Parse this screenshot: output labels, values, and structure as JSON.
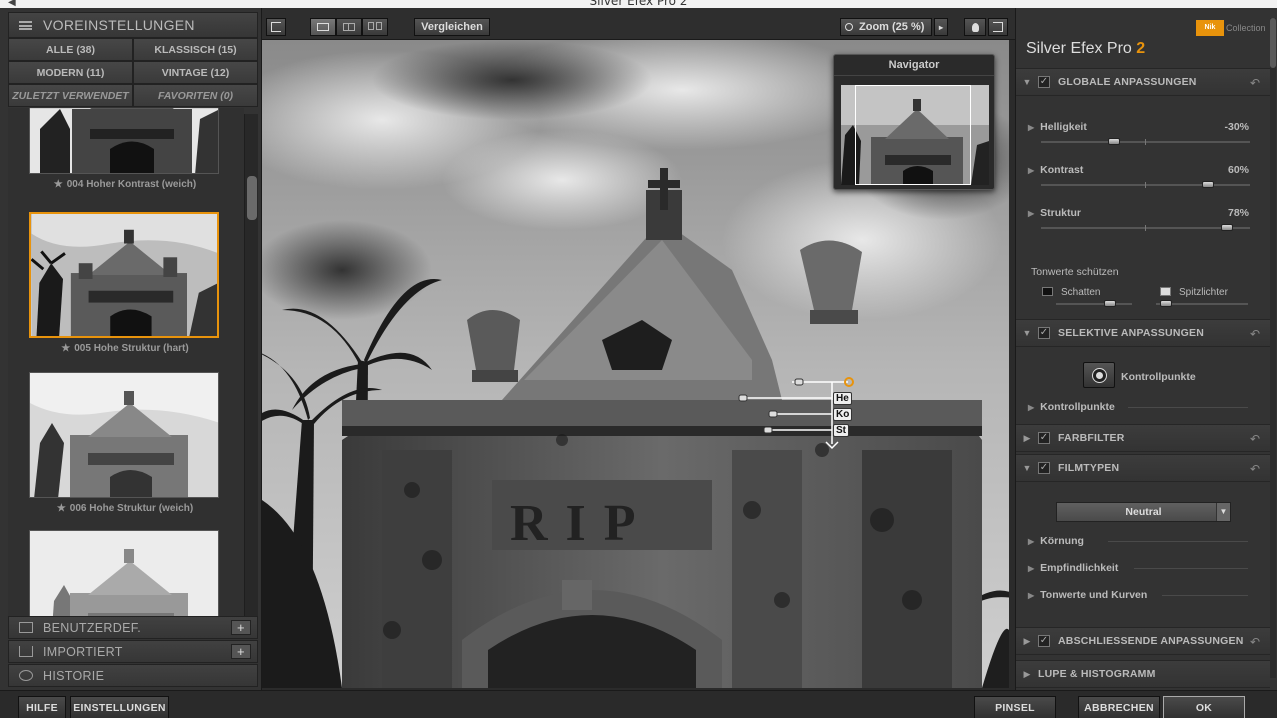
{
  "window": {
    "title": "Silver Efex Pro 2"
  },
  "left_panel": {
    "header": "VOREINSTELLUNGEN",
    "filters": [
      {
        "label": "ALLE (38)"
      },
      {
        "label": "KLASSISCH (15)"
      },
      {
        "label": "MODERN (11)"
      },
      {
        "label": "VINTAGE (12)"
      },
      {
        "label": "ZULETZT VERWENDET"
      },
      {
        "label": "FAVORITEN (0)"
      }
    ],
    "presets": [
      {
        "label": "004 Hoher Kontrast (weich)"
      },
      {
        "label": "005 Hohe Struktur (hart)"
      },
      {
        "label": "006 Hohe Struktur (weich)"
      },
      {
        "label": ""
      }
    ],
    "sections": [
      {
        "label": "BENUTZERDEF."
      },
      {
        "label": "IMPORTIERT"
      },
      {
        "label": "HISTORIE"
      }
    ],
    "star": "★",
    "plus": "+"
  },
  "toolbar": {
    "compare": "Vergleichen",
    "zoom": "Zoom (25 %)"
  },
  "navigator": {
    "title": "Navigator"
  },
  "control_point": {
    "labels": [
      "He",
      "Ko",
      "St"
    ]
  },
  "right_panel": {
    "logo": {
      "nik": "Nik",
      "collection": "Collection"
    },
    "product": {
      "name": "Silver Efex Pro",
      "version": "2"
    },
    "global": {
      "title": "GLOBALE ANPASSUNGEN",
      "sliders": [
        {
          "label": "Helligkeit",
          "value_text": "-30%",
          "value": -30
        },
        {
          "label": "Kontrast",
          "value_text": "60%",
          "value": 60
        },
        {
          "label": "Struktur",
          "value_text": "78%",
          "value": 78
        }
      ],
      "protect_title": "Tonwerte schützen",
      "shadows": "Schatten",
      "highlights": "Spitzlichter"
    },
    "selective": {
      "title": "SELEKTIVE ANPASSUNGEN",
      "button": "Kontrollpunkte",
      "sub": "Kontrollpunkte"
    },
    "color_filter": {
      "title": "FARBFILTER"
    },
    "film": {
      "title": "FILMTYPEN",
      "dropdown": "Neutral",
      "items": [
        "Körnung",
        "Empfindlichkeit",
        "Tonwerte und Kurven"
      ]
    },
    "finishing": {
      "title": "ABSCHLIESSENDE ANPASSUNGEN"
    },
    "loupe": {
      "title": "LUPE & HISTOGRAMM"
    }
  },
  "bottom": {
    "help": "HILFE",
    "settings": "EINSTELLUNGEN",
    "brush": "PINSEL",
    "cancel": "ABBRECHEN",
    "ok": "OK"
  }
}
